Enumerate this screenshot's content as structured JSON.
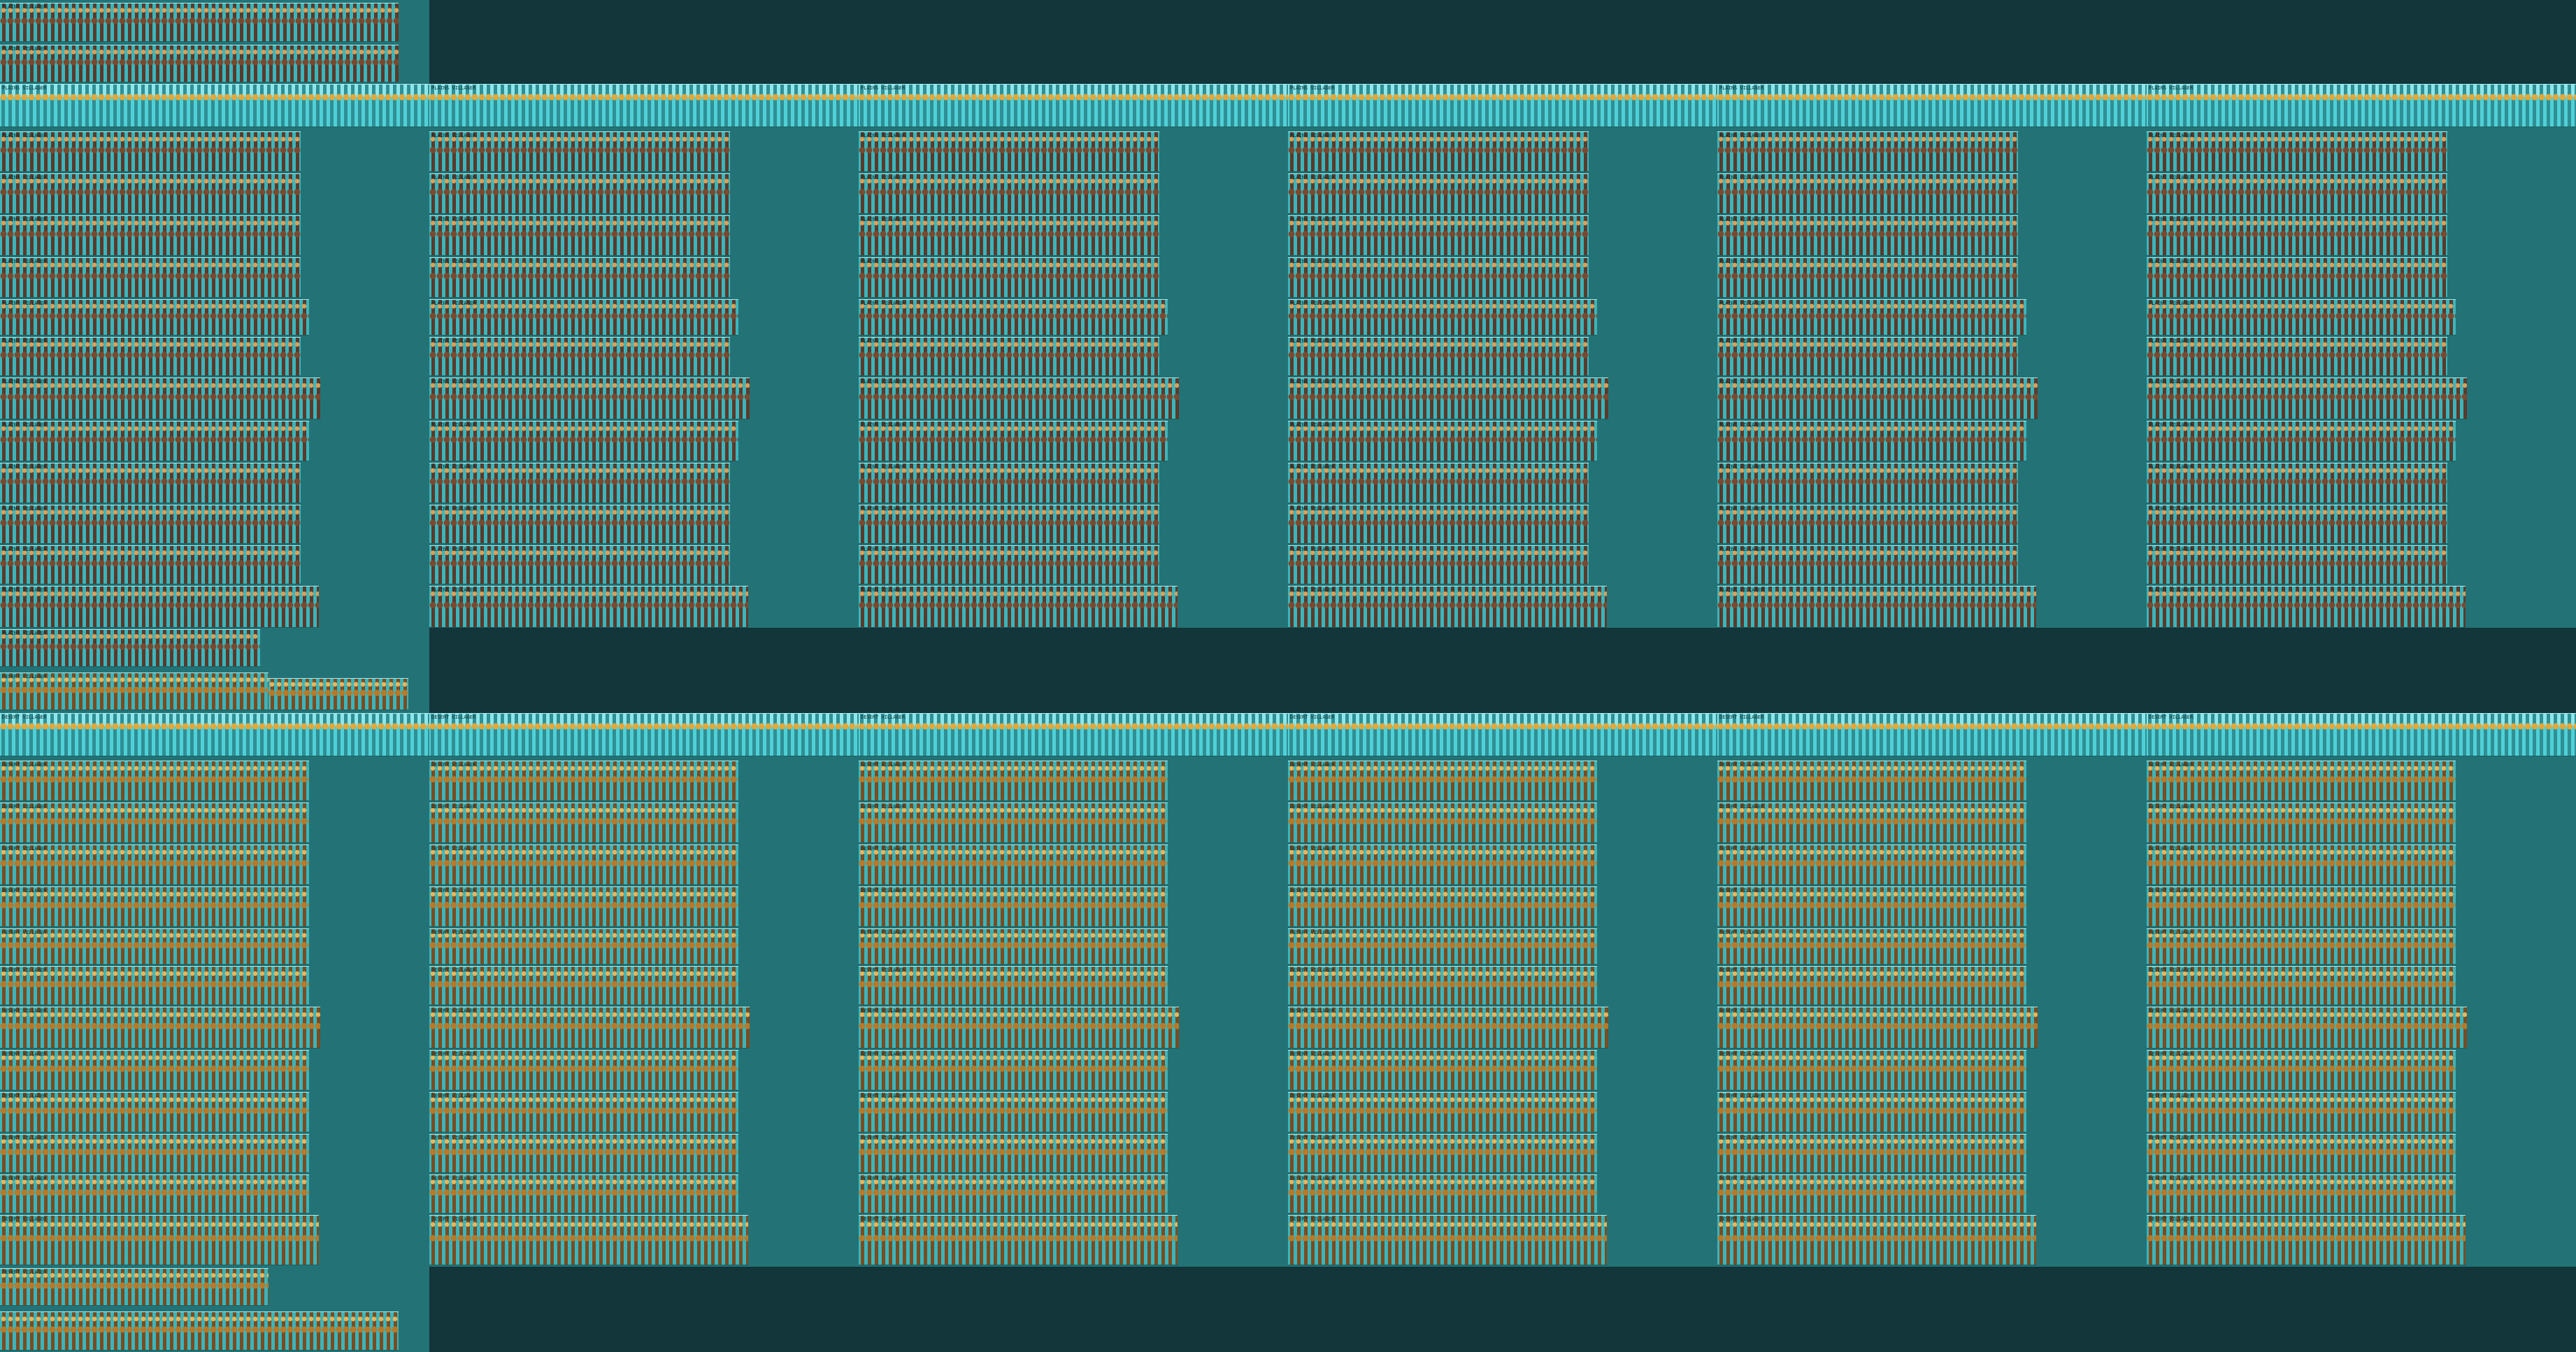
{
  "sheet": {
    "background": "#12363a",
    "panel_color": "#237376",
    "strip_color": "#3bb5bb"
  },
  "top_group": {
    "header_rows": [
      {
        "label": "PLAINS VILLAGER"
      },
      {
        "label": "PLAINS VILLAGER"
      }
    ],
    "columns": [
      {
        "header": "PLAINS VILLAGER",
        "rows": [
          {
            "label": "PLAINS VILLAGER"
          },
          {
            "label": "PLAINS VILLAGER"
          },
          {
            "label": "PLAINS VILLAGER"
          },
          {
            "label": "PLAINS VILLAGER"
          },
          {
            "label": "PLAINS VILLAGER"
          },
          {
            "label": "PLAINS VILLAGER"
          },
          {
            "label": "PLAINS VILLAGER"
          },
          {
            "label": "PLAINS VILLAGER"
          },
          {
            "label": "PLAINS VILLAGER"
          },
          {
            "label": "PLAINS VILLAGER"
          },
          {
            "label": "PLAINS VILLAGER"
          },
          {
            "label": "PLAINS VILLAGER"
          }
        ]
      },
      {
        "header": "PLAINS VILLAGER",
        "rows": [
          {
            "label": "PLAINS VILLAGER"
          },
          {
            "label": "PLAINS VILLAGER"
          },
          {
            "label": "PLAINS VILLAGER"
          },
          {
            "label": "PLAINS VILLAGER"
          },
          {
            "label": "PLAINS VILLAGER"
          },
          {
            "label": "PLAINS VILLAGER"
          },
          {
            "label": "PLAINS VILLAGER"
          },
          {
            "label": "PLAINS VILLAGER"
          },
          {
            "label": "PLAINS VILLAGER"
          },
          {
            "label": "PLAINS VILLAGER"
          },
          {
            "label": "PLAINS VILLAGER"
          },
          {
            "label": "PLAINS VILLAGER"
          }
        ]
      },
      {
        "header": "PLAINS VILLAGER",
        "rows": [
          {
            "label": "PLAINS VILLAGER"
          },
          {
            "label": "PLAINS VILLAGER"
          },
          {
            "label": "PLAINS VILLAGER"
          },
          {
            "label": "PLAINS VILLAGER"
          },
          {
            "label": "PLAINS VILLAGER"
          },
          {
            "label": "PLAINS VILLAGER"
          },
          {
            "label": "PLAINS VILLAGER"
          },
          {
            "label": "PLAINS VILLAGER"
          },
          {
            "label": "PLAINS VILLAGER"
          },
          {
            "label": "PLAINS VILLAGER"
          },
          {
            "label": "PLAINS VILLAGER"
          },
          {
            "label": "PLAINS VILLAGER"
          }
        ]
      },
      {
        "header": "PLAINS VILLAGER",
        "rows": [
          {
            "label": "PLAINS VILLAGER"
          },
          {
            "label": "PLAINS VILLAGER"
          },
          {
            "label": "PLAINS VILLAGER"
          },
          {
            "label": "PLAINS VILLAGER"
          },
          {
            "label": "PLAINS VILLAGER"
          },
          {
            "label": "PLAINS VILLAGER"
          },
          {
            "label": "PLAINS VILLAGER"
          },
          {
            "label": "PLAINS VILLAGER"
          },
          {
            "label": "PLAINS VILLAGER"
          },
          {
            "label": "PLAINS VILLAGER"
          },
          {
            "label": "PLAINS VILLAGER"
          },
          {
            "label": "PLAINS VILLAGER"
          }
        ]
      },
      {
        "header": "PLAINS VILLAGER",
        "rows": [
          {
            "label": "PLAINS VILLAGER"
          },
          {
            "label": "PLAINS VILLAGER"
          },
          {
            "label": "PLAINS VILLAGER"
          },
          {
            "label": "PLAINS VILLAGER"
          },
          {
            "label": "PLAINS VILLAGER"
          },
          {
            "label": "PLAINS VILLAGER"
          },
          {
            "label": "PLAINS VILLAGER"
          },
          {
            "label": "PLAINS VILLAGER"
          },
          {
            "label": "PLAINS VILLAGER"
          },
          {
            "label": "PLAINS VILLAGER"
          },
          {
            "label": "PLAINS VILLAGER"
          },
          {
            "label": "PLAINS VILLAGER"
          }
        ]
      },
      {
        "header": "PLAINS VILLAGER",
        "rows": [
          {
            "label": "PLAINS VILLAGER"
          },
          {
            "label": "PLAINS VILLAGER"
          },
          {
            "label": "PLAINS VILLAGER"
          },
          {
            "label": "PLAINS VILLAGER"
          },
          {
            "label": "PLAINS VILLAGER"
          },
          {
            "label": "PLAINS VILLAGER"
          },
          {
            "label": "PLAINS VILLAGER"
          },
          {
            "label": "PLAINS VILLAGER"
          },
          {
            "label": "PLAINS VILLAGER"
          },
          {
            "label": "PLAINS VILLAGER"
          },
          {
            "label": "PLAINS VILLAGER"
          },
          {
            "label": "PLAINS VILLAGER"
          }
        ]
      }
    ],
    "footer_row": {
      "label": "PLAINS VILLAGER"
    }
  },
  "bottom_group": {
    "header_rows": [
      {
        "label": "DESERT VILLAGER"
      }
    ],
    "columns": [
      {
        "header": "DESERT VILLAGER",
        "rows": [
          {
            "label": "DESERT VILLAGER"
          },
          {
            "label": "DESERT VILLAGER"
          },
          {
            "label": "DESERT VILLAGER"
          },
          {
            "label": "DESERT VILLAGER"
          },
          {
            "label": "DESERT VILLAGER"
          },
          {
            "label": "DESERT VILLAGER"
          },
          {
            "label": "DESERT VILLAGER"
          },
          {
            "label": "DESERT VILLAGER"
          },
          {
            "label": "DESERT VILLAGER"
          },
          {
            "label": "DESERT VILLAGER"
          },
          {
            "label": "DESERT VILLAGER"
          },
          {
            "label": "DESERT VILLAGER"
          }
        ]
      },
      {
        "header": "DESERT VILLAGER",
        "rows": [
          {
            "label": "DESERT VILLAGER"
          },
          {
            "label": "DESERT VILLAGER"
          },
          {
            "label": "DESERT VILLAGER"
          },
          {
            "label": "DESERT VILLAGER"
          },
          {
            "label": "DESERT VILLAGER"
          },
          {
            "label": "DESERT VILLAGER"
          },
          {
            "label": "DESERT VILLAGER"
          },
          {
            "label": "DESERT VILLAGER"
          },
          {
            "label": "DESERT VILLAGER"
          },
          {
            "label": "DESERT VILLAGER"
          },
          {
            "label": "DESERT VILLAGER"
          },
          {
            "label": "DESERT VILLAGER"
          }
        ]
      },
      {
        "header": "DESERT VILLAGER",
        "rows": [
          {
            "label": "DESERT VILLAGER"
          },
          {
            "label": "DESERT VILLAGER"
          },
          {
            "label": "DESERT VILLAGER"
          },
          {
            "label": "DESERT VILLAGER"
          },
          {
            "label": "DESERT VILLAGER"
          },
          {
            "label": "DESERT VILLAGER"
          },
          {
            "label": "DESERT VILLAGER"
          },
          {
            "label": "DESERT VILLAGER"
          },
          {
            "label": "DESERT VILLAGER"
          },
          {
            "label": "DESERT VILLAGER"
          },
          {
            "label": "DESERT VILLAGER"
          },
          {
            "label": "DESERT VILLAGER"
          }
        ]
      },
      {
        "header": "DESERT VILLAGER",
        "rows": [
          {
            "label": "DESERT VILLAGER"
          },
          {
            "label": "DESERT VILLAGER"
          },
          {
            "label": "DESERT VILLAGER"
          },
          {
            "label": "DESERT VILLAGER"
          },
          {
            "label": "DESERT VILLAGER"
          },
          {
            "label": "DESERT VILLAGER"
          },
          {
            "label": "DESERT VILLAGER"
          },
          {
            "label": "DESERT VILLAGER"
          },
          {
            "label": "DESERT VILLAGER"
          },
          {
            "label": "DESERT VILLAGER"
          },
          {
            "label": "DESERT VILLAGER"
          },
          {
            "label": "DESERT VILLAGER"
          }
        ]
      },
      {
        "header": "DESERT VILLAGER",
        "rows": [
          {
            "label": "DESERT VILLAGER"
          },
          {
            "label": "DESERT VILLAGER"
          },
          {
            "label": "DESERT VILLAGER"
          },
          {
            "label": "DESERT VILLAGER"
          },
          {
            "label": "DESERT VILLAGER"
          },
          {
            "label": "DESERT VILLAGER"
          },
          {
            "label": "DESERT VILLAGER"
          },
          {
            "label": "DESERT VILLAGER"
          },
          {
            "label": "DESERT VILLAGER"
          },
          {
            "label": "DESERT VILLAGER"
          },
          {
            "label": "DESERT VILLAGER"
          },
          {
            "label": "DESERT VILLAGER"
          }
        ]
      },
      {
        "header": "DESERT VILLAGER",
        "rows": [
          {
            "label": "DESERT VILLAGER"
          },
          {
            "label": "DESERT VILLAGER"
          },
          {
            "label": "DESERT VILLAGER"
          },
          {
            "label": "DESERT VILLAGER"
          },
          {
            "label": "DESERT VILLAGER"
          },
          {
            "label": "DESERT VILLAGER"
          },
          {
            "label": "DESERT VILLAGER"
          },
          {
            "label": "DESERT VILLAGER"
          },
          {
            "label": "DESERT VILLAGER"
          },
          {
            "label": "DESERT VILLAGER"
          },
          {
            "label": "DESERT VILLAGER"
          },
          {
            "label": "DESERT VILLAGER"
          }
        ]
      }
    ],
    "footer_row": {
      "label": "DESERT VILLAGER"
    }
  }
}
